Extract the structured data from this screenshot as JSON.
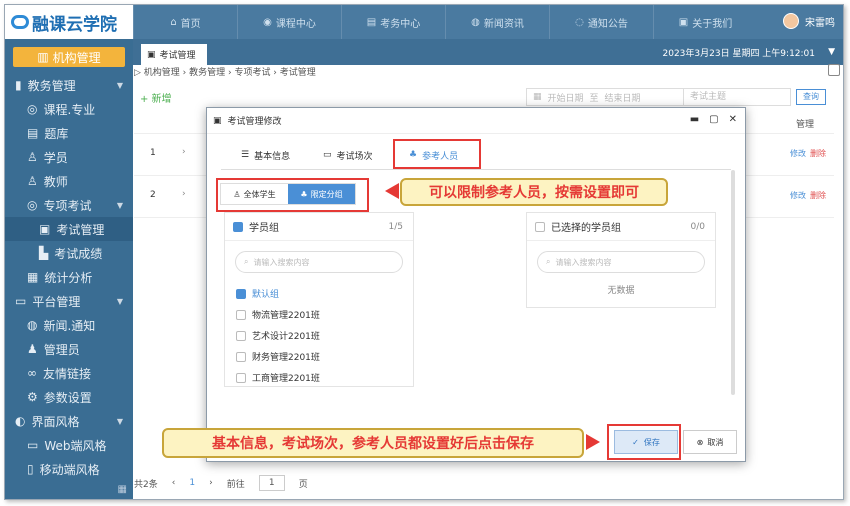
{
  "app": {
    "logo_text": "融课云学院",
    "user_name": "宋雷鸣",
    "datetime": "2023年3月23日 星期四 上午9:12:01"
  },
  "nav": [
    {
      "icon": "home-icon",
      "label": "首页"
    },
    {
      "icon": "course-icon",
      "label": "课程中心"
    },
    {
      "icon": "exam-icon",
      "label": "考务中心"
    },
    {
      "icon": "news-icon",
      "label": "新闻资讯"
    },
    {
      "icon": "bell-icon",
      "label": "通知公告"
    },
    {
      "icon": "about-icon",
      "label": "关于我们"
    }
  ],
  "sidebar": {
    "org_label": "机构管理",
    "items": [
      {
        "label": "教务管理",
        "level": 1,
        "arrow": true
      },
      {
        "label": "课程.专业",
        "level": 2
      },
      {
        "label": "题库",
        "level": 2
      },
      {
        "label": "学员",
        "level": 2
      },
      {
        "label": "教师",
        "level": 2
      },
      {
        "label": "专项考试",
        "level": 2,
        "arrow": true
      },
      {
        "label": "考试管理",
        "level": 3
      },
      {
        "label": "考试成绩",
        "level": 3
      },
      {
        "label": "统计分析",
        "level": 2
      },
      {
        "label": "平台管理",
        "level": 1,
        "arrow": true
      },
      {
        "label": "新闻.通知",
        "level": 2
      },
      {
        "label": "管理员",
        "level": 2
      },
      {
        "label": "友情链接",
        "level": 2
      },
      {
        "label": "参数设置",
        "level": 2
      },
      {
        "label": "界面风格",
        "level": 1,
        "arrow": true
      },
      {
        "label": "Web端风格",
        "level": 2
      },
      {
        "label": "移动端风格",
        "level": 2
      }
    ]
  },
  "tab": {
    "label": "考试管理"
  },
  "breadcrumb": "机构管理 › 教务管理 › 专项考试 › 考试管理",
  "toolbar": {
    "add_label": "+ 新增",
    "start_date": "开始日期",
    "end_date": "结束日期",
    "subject_placeholder": "考试主题",
    "query_label": "查询"
  },
  "table": {
    "op_header": "管理",
    "rows": [
      {
        "no": "1",
        "edit": "修改",
        "del": "删除"
      },
      {
        "no": "2",
        "edit": "修改",
        "del": "删除"
      }
    ]
  },
  "pager": {
    "total": "共2条",
    "current": "1",
    "goto_label": "前往",
    "page_value": "1",
    "page_unit": "页"
  },
  "modal": {
    "title": "考试管理修改",
    "tabs": [
      "基本信息",
      "考试场次",
      "参考人员"
    ],
    "seg": [
      "全体学生",
      "限定分组"
    ],
    "left_panel": {
      "title": "学员组",
      "count": "1/5",
      "search_placeholder": "请输入搜索内容",
      "groups": [
        {
          "label": "默认组",
          "checked": true
        },
        {
          "label": "物流管理2201班",
          "checked": false
        },
        {
          "label": "艺术设计2201班",
          "checked": false
        },
        {
          "label": "财务管理2201班",
          "checked": false
        },
        {
          "label": "工商管理2201班",
          "checked": false
        }
      ]
    },
    "right_panel": {
      "title": "已选择的学员组",
      "count": "0/0",
      "search_placeholder": "请输入搜索内容",
      "empty": "无数据"
    },
    "save_label": "保存",
    "cancel_label": "取消"
  },
  "callouts": {
    "top": "可以限制参考人员，按需设置即可",
    "bottom": "基本信息，考试场次，参考人员都设置好后点击保存"
  },
  "colors": {
    "accent": "#4a8fd6",
    "sidebar": "#3a6d93",
    "highlight": "#e53935",
    "callout_bg": "#fdf3c2"
  }
}
